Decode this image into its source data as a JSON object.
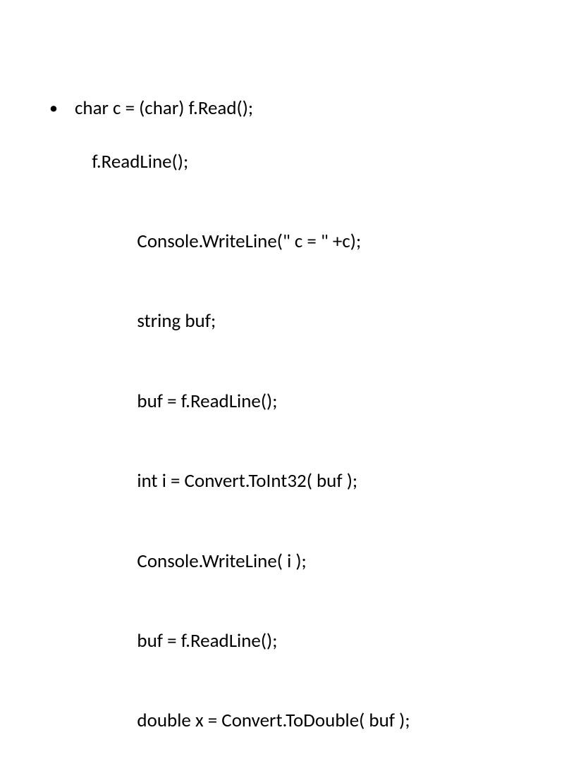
{
  "code": {
    "line1": "char c = (char) f.Read();",
    "line2": "f.ReadLine();",
    "line3": "Console.WriteLine(\" c = \" +c);",
    "line4": "string buf;",
    "line5": "buf = f.ReadLine();",
    "line6": "int i = Convert.ToInt32( buf );",
    "line7": "Console.WriteLine( i );",
    "line8": "buf = f.ReadLine();",
    "line9": "double x = Convert.ToDouble( buf );"
  },
  "bullet": "•"
}
